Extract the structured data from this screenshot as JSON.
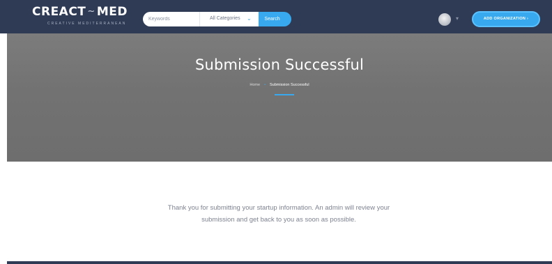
{
  "header": {
    "logo_text_left": "CREACT",
    "logo_text_mid": "~",
    "logo_text_right": "MED",
    "logo_tagline": "CREATIVE MEDITERRANEAN",
    "search": {
      "keywords_placeholder": "Keywords",
      "category_selected": "All Categories",
      "search_button": "Search"
    },
    "add_organization_label": "ADD ORGANIZATION  ›"
  },
  "hero": {
    "title": "Submission Successful",
    "breadcrumb": {
      "home": "Home",
      "separator": "•",
      "current": "Submission Successful"
    }
  },
  "content": {
    "message_line1": "Thank you for submitting your startup information. An admin will review your",
    "message_line2": "submission and get back to you as soon as possible."
  },
  "colors": {
    "nav_bg": "#2f3b55",
    "accent": "#38a9ee",
    "hero_bg": "#747474",
    "body_text": "#7d8290"
  },
  "icons": {
    "category_dropdown": "chevron-down-icon",
    "user_menu": "caret-down-icon"
  }
}
